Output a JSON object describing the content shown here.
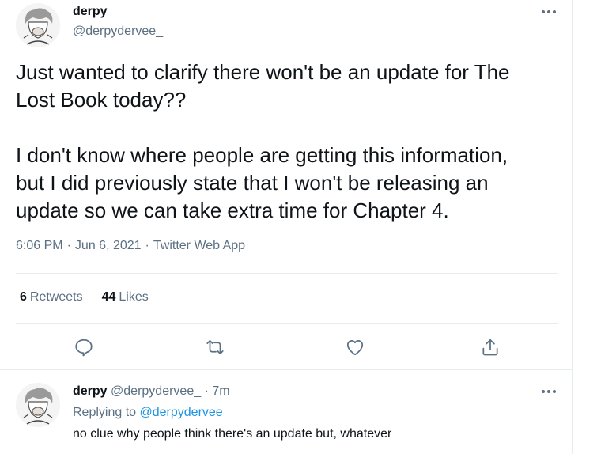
{
  "tweet": {
    "author_name": "derpy",
    "author_handle": "@derpydervee_",
    "paragraphs": [
      [
        "Just wanted to clarify there won't be an update for The",
        "Lost Book today??"
      ],
      [
        "I don't know where people are getting this information,",
        "but I did previously state that I won't be releasing an",
        "update so we can take extra time for Chapter 4."
      ]
    ],
    "time": "6:06 PM",
    "date": "Jun 6, 2021",
    "source": "Twitter Web App",
    "separator": "·",
    "retweet_count": "6",
    "retweet_label": "Retweets",
    "like_count": "44",
    "like_label": "Likes"
  },
  "actions": {
    "reply_icon": "reply-icon",
    "retweet_icon": "retweet-icon",
    "like_icon": "heart-icon",
    "share_icon": "share-icon"
  },
  "reply": {
    "author_name": "derpy",
    "author_handle": "@derpydervee_",
    "separator": "·",
    "age": "7m",
    "replying_prefix": "Replying to",
    "replying_handle": "@derpydervee_",
    "text": "no clue why people think there's an update but, whatever"
  },
  "colors": {
    "text": "#0f1419",
    "secondary": "#5b7083",
    "link": "#1b95e0",
    "border": "#e6ecf0"
  }
}
